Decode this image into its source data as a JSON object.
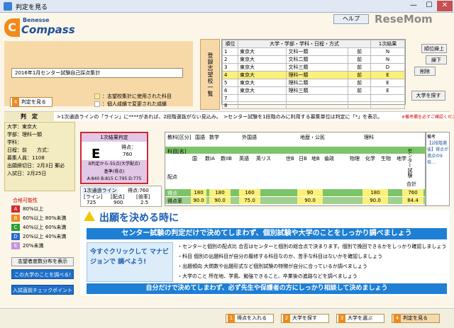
{
  "window": {
    "title": "判定を見る",
    "minimize": "—",
    "maximize": "☐",
    "close": "✕"
  },
  "logo": {
    "brand": "Benesse",
    "product": "Compass"
  },
  "help_label": "ヘルプ",
  "watermark": "ReseMom",
  "exam_select": "2016年1月センター試験自己採点集計",
  "judge_button": {
    "num": "4",
    "label": "判定を見る"
  },
  "legend": [
    "：志望校集計に使用された科目",
    "：個人成績で変更された成績"
  ],
  "shibo_label": "登録志望校一覧",
  "list": {
    "headers": [
      "順位",
      "大学・学部・学科・日程・方式",
      "",
      "1次結果"
    ],
    "rows": [
      {
        "n": "1",
        "univ": "東京大",
        "dept": "文科一類",
        "term": "前",
        "res": "N"
      },
      {
        "n": "2",
        "univ": "東京大",
        "dept": "文科二類",
        "term": "前",
        "res": "N"
      },
      {
        "n": "3",
        "univ": "東京大",
        "dept": "文科三類",
        "term": "前",
        "res": "D"
      },
      {
        "n": "4",
        "univ": "東京大",
        "dept": "理科一類",
        "term": "前",
        "res": "E"
      },
      {
        "n": "5",
        "univ": "東京大",
        "dept": "理科二類",
        "term": "前",
        "res": "E"
      },
      {
        "n": "6",
        "univ": "東京大",
        "dept": "理科三類",
        "term": "前",
        "res": "E"
      },
      {
        "n": "7",
        "univ": "",
        "dept": "",
        "term": "",
        "res": ""
      },
      {
        "n": "8",
        "univ": "",
        "dept": "",
        "term": "",
        "res": ""
      }
    ]
  },
  "side_buttons": {
    "up": "順位繰上",
    "down": "繰下",
    "delete": "削除"
  },
  "find_button": "大学を探す",
  "judge_bar": {
    "label": "判　定",
    "text": ">1次通過ラインの「ライン」に****があれば、2段階選抜がない見込み。　>センター試験を1段階のみに利用する募集単位は判定に「*」を表示。",
    "warning": "※備考欄を必ずご確認ください"
  },
  "info": {
    "univ": "大学：東京大",
    "faculty": "学部：理科一類",
    "dept": "学科：",
    "term": "日程：前　　方式：",
    "capacity": "募集人員：1108",
    "deadline": "出願締切日：2月3日 郵必",
    "exam_date": "入試日：2月25日"
  },
  "judge_box": {
    "title": "1次結果判定",
    "grade": "E",
    "score_label": "得点：",
    "score": "760",
    "mid": "B判定から-55点(大学配点)",
    "mid2": "基準(得点)",
    "bot": "A:840 B:815 C:795 D:775"
  },
  "pass_line": {
    "title": "1次通過ライン",
    "score_label": "得点:760",
    "h1": "[ライン]",
    "h2": "[配点]",
    "h3": "[倍率]",
    "v1": "725",
    "v2": "900",
    "v3": "2.5"
  },
  "score_table": {
    "row_labels": [
      "教科[区分]",
      "科目[名]",
      "配点",
      "得点",
      "得点率"
    ],
    "groups": [
      "国語",
      "数学",
      "外国語",
      "地歴・公民",
      "理科"
    ],
    "subjects": [
      "国",
      "数IA",
      "数IIB",
      "英語",
      "英リス",
      "世B",
      "日B",
      "地B",
      "倫政",
      "物理",
      "化学",
      "生物",
      "地学",
      "センター試験"
    ],
    "scores": [
      "180",
      "180",
      "160",
      "90",
      "180",
      "84.4"
    ],
    "rates": [
      "90.0",
      "90.0",
      "75.0",
      "90.0",
      "90.0",
      "合計"
    ],
    "total_label": "合計",
    "total_score": "760"
  },
  "notes": {
    "title": "備考",
    "text": "【2段階選抜】得点が満点の9倍…"
  },
  "pass_prob": {
    "title": "合格可能性",
    "rows": [
      {
        "g": "A",
        "t": "80%以上",
        "c": "#d42a2a"
      },
      {
        "g": "B",
        "t": "60%以上 80%未満",
        "c": "#f08a1c"
      },
      {
        "g": "C",
        "t": "40%以上 60%未満",
        "c": "#2f9f3a"
      },
      {
        "g": "D",
        "t": "20%以上 40%未満",
        "c": "#2a6ad0"
      },
      {
        "g": "E",
        "t": "20%未満",
        "c": "#c892d8"
      }
    ]
  },
  "dist_button": "志望者度数分布を表示",
  "blue_buttons": [
    "この大学のことを調べる!",
    "入試直前チェックポイント"
  ],
  "ad": {
    "title": "出願を決める時に",
    "banner": "センター試験の判定だけで決めてしまわず、個別試験や大学のことをしっかり調べましょう",
    "left_text": "今すぐクリックして マナビジョンで 調べよう!",
    "lines": [
      "・センターと個別の配点比 合否はセンターと個別の総合点で決まります。個別で挽回できるかをしっかり確認しましょう",
      "・科目 個別の出題科目が自分の履修する科目なのか、苦手な科目はないかを確認しましょう",
      "・出題傾向 大問数や出題形式など個別試験の特徴が自分に合っているか調べましょう",
      "・大学のこと 所在地、学風、勉強できること、卒業後の進路などを調べましょう"
    ],
    "bottom": "自分だけで決めてしまわず、必ず先生や保護者の方にしっかり相談して決めましょう"
  },
  "nav": [
    {
      "n": "1",
      "t": "得点を入れる"
    },
    {
      "n": "2",
      "t": "大学を探す"
    },
    {
      "n": "3",
      "t": "大学を選ぶ"
    },
    {
      "n": "4",
      "t": "判定を見る"
    }
  ]
}
